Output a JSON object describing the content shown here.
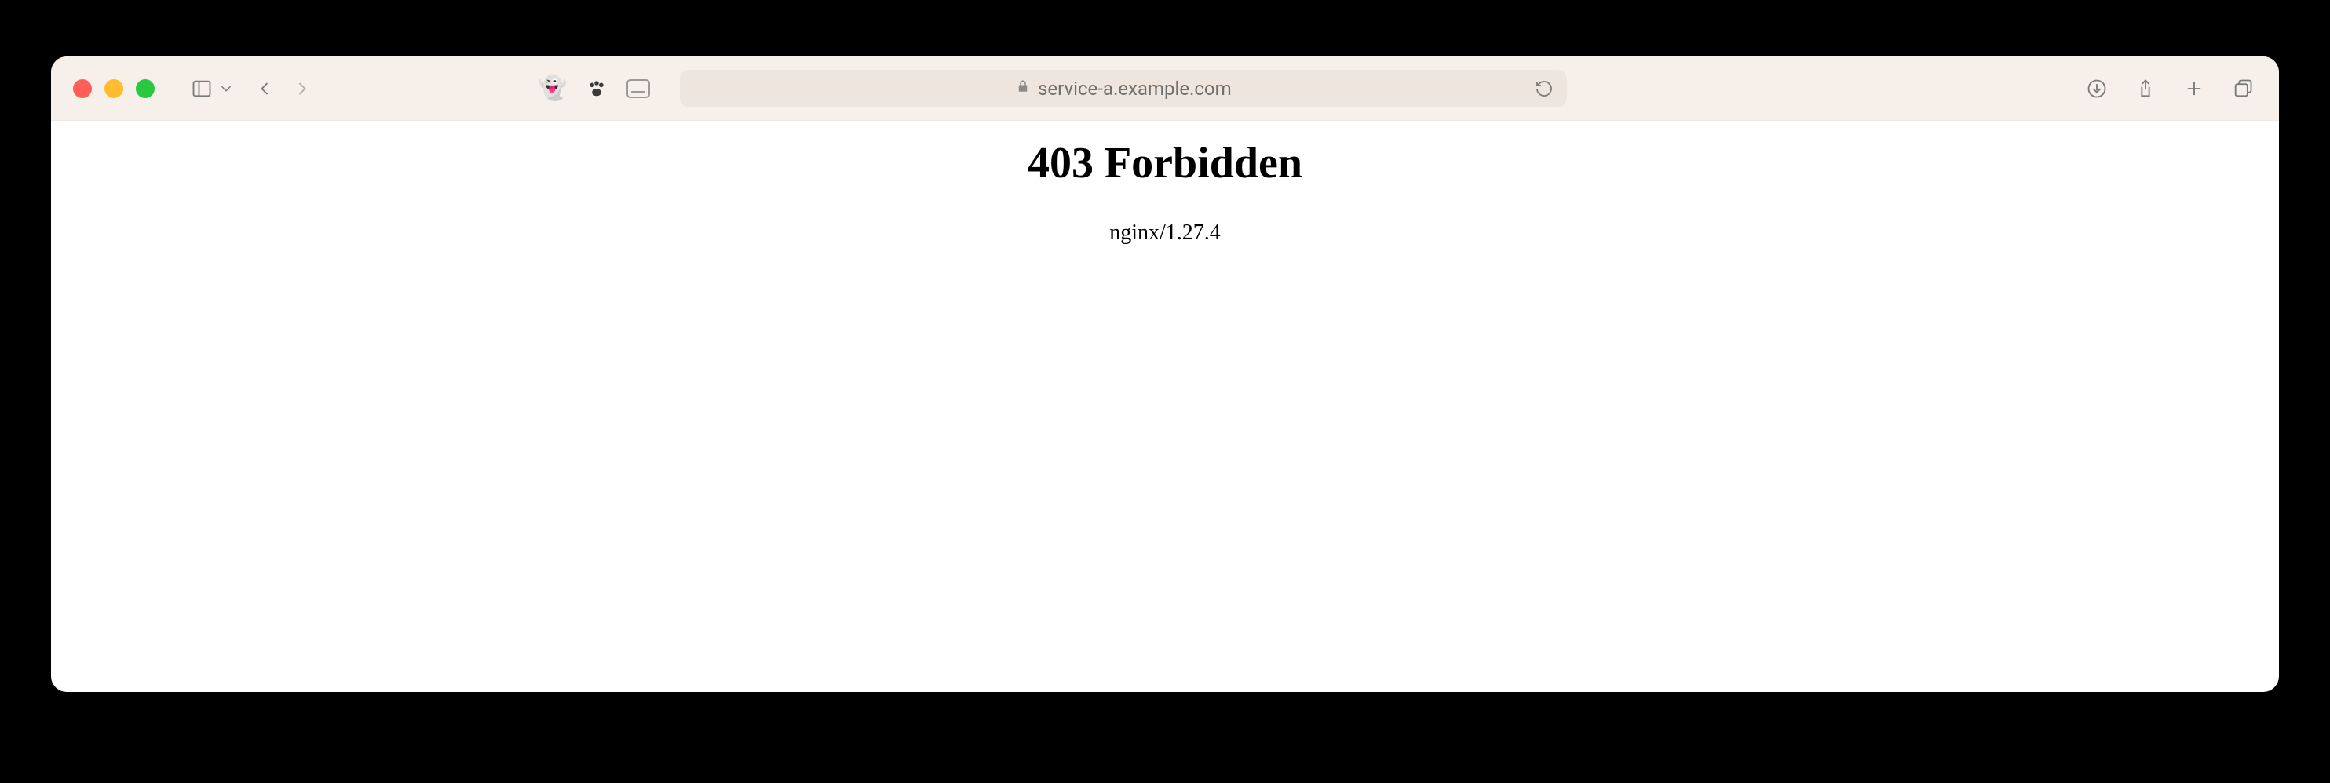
{
  "address_bar": {
    "host": "service-a.example.com"
  },
  "page": {
    "error_title": "403 Forbidden",
    "server_line": "nginx/1.27.4"
  }
}
